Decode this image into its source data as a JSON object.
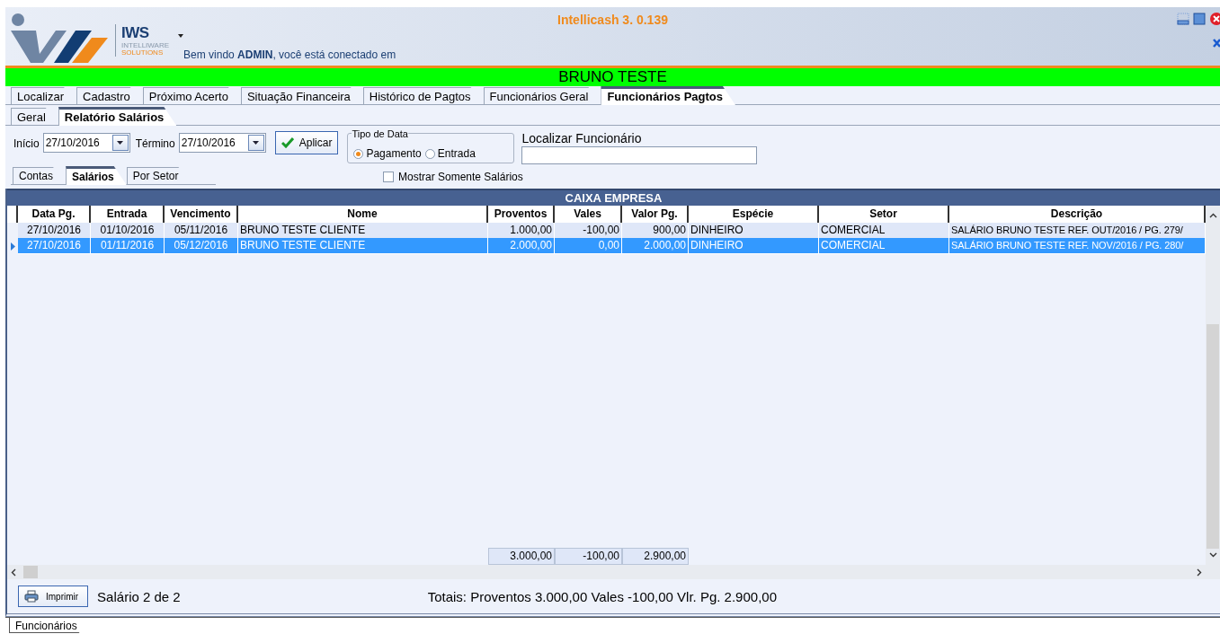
{
  "window": {
    "title": "Intellicash 3. 0.139",
    "welcome": "Bem vindo **ADMIN**, você está conectado em"
  },
  "logo": {
    "text": "IWS",
    "subtitle_1": "INTELLIWARE",
    "subtitle_2": "SOLUTIONS"
  },
  "client_banner": "BRUNO TESTE",
  "tabs": [
    {
      "label": "Localizar",
      "selected": false
    },
    {
      "label": "Cadastro",
      "selected": false
    },
    {
      "label": "Próximo Acerto",
      "selected": false
    },
    {
      "label": "Situação Financeira",
      "selected": false
    },
    {
      "label": "Histórico de Pagtos",
      "selected": false
    },
    {
      "label": "Funcionários Geral",
      "selected": false
    },
    {
      "label": "Funcionários Pagtos",
      "selected": true
    }
  ],
  "subtabs": [
    {
      "label": "Geral",
      "selected": false
    },
    {
      "label": "Relatório Salários",
      "selected": true
    }
  ],
  "filters": {
    "start_label": "Início",
    "start_value": "27/10/2016",
    "end_label": "Término",
    "end_value": "27/10/2016",
    "apply_button": "Aplicar",
    "date_type": {
      "title": "Tipo de Data",
      "options": [
        {
          "label": "Pagamento",
          "selected": true
        },
        {
          "label": "Entrada",
          "selected": false
        }
      ]
    },
    "only_salaries": {
      "label": "Mostrar Somente Salários",
      "checked": false
    },
    "search": {
      "label": "Localizar Funcionário"
    }
  },
  "view_tabs": [
    {
      "label": "Contas",
      "selected": false
    },
    {
      "label": "Salários",
      "selected": true
    },
    {
      "label": "Por Setor",
      "selected": false
    }
  ],
  "table": {
    "title": "CAIXA EMPRESA",
    "columns": [
      "Data Pg.",
      "Entrada",
      "Vencimento",
      "Nome",
      "Proventos",
      "Vales",
      "Valor Pg.",
      "Espécie",
      "Setor",
      "Descrição"
    ],
    "rows": [
      {
        "selected": false,
        "cells": [
          "27/10/2016",
          "01/10/2016",
          "05/11/2016",
          "BRUNO TESTE CLIENTE",
          "1.000,00",
          "-100,00",
          "900,00",
          "DINHEIRO",
          "COMERCIAL",
          "SALÁRIO BRUNO TESTE REF. OUT/2016 / PG. 279/"
        ]
      },
      {
        "selected": true,
        "cells": [
          "27/10/2016",
          "01/11/2016",
          "05/12/2016",
          "BRUNO TESTE CLIENTE",
          "2.000,00",
          "0,00",
          "2.000,00",
          "DINHEIRO",
          "COMERCIAL",
          "SALÁRIO BRUNO TESTE REF. NOV/2016 / PG. 280/"
        ]
      }
    ],
    "totals": [
      "3.000,00",
      "-100,00",
      "2.900,00"
    ]
  },
  "footer": {
    "print_button": "Imprimir",
    "record_count": "Salário 2 de 2",
    "totals": "Totais: Proventos 3.000,00 Vales -100,00 Vlr. Pg. 2.900,00"
  },
  "bottom_tabs": [
    {
      "label": "Funcionários",
      "selected": true
    }
  ]
}
